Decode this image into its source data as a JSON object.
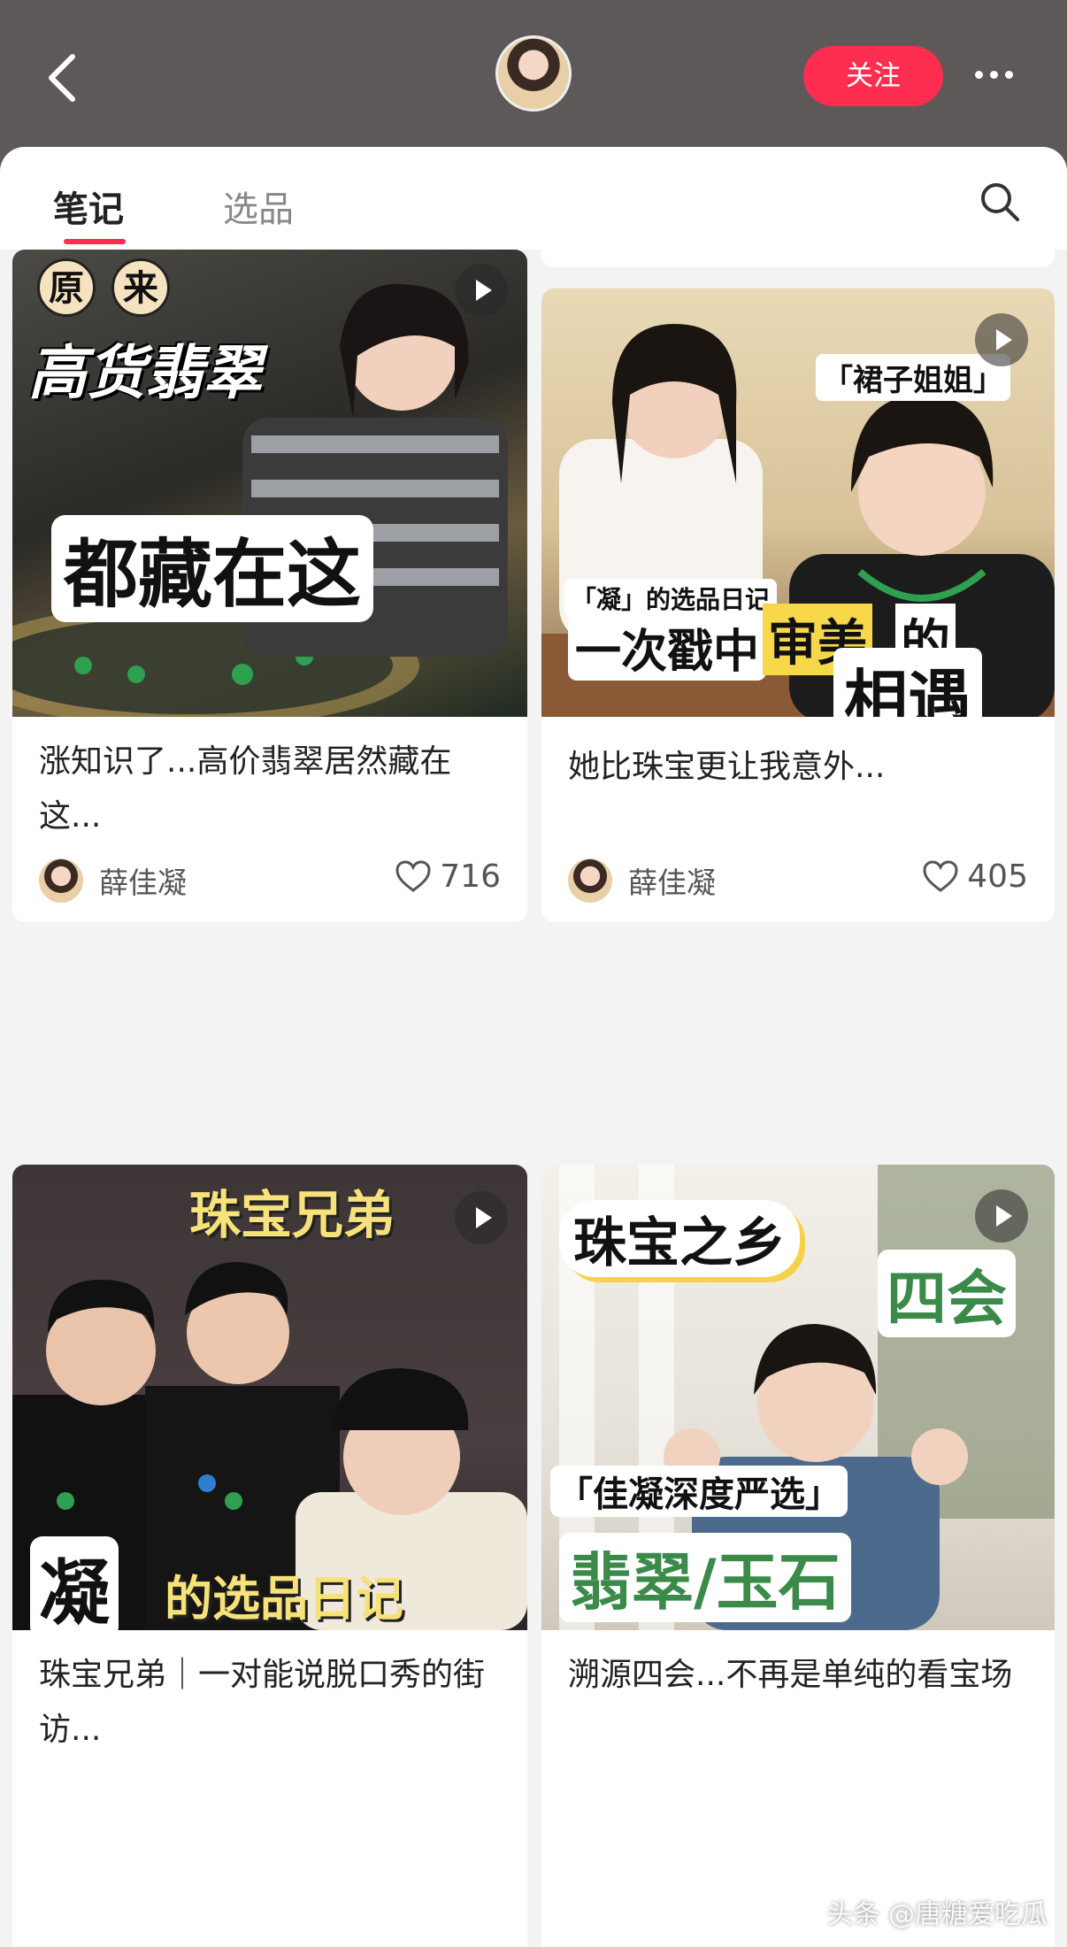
{
  "header": {
    "follow_label": "关注"
  },
  "tabs": [
    {
      "label": "笔记",
      "active": true
    },
    {
      "label": "选品",
      "active": false
    }
  ],
  "cards": [
    {
      "cover_text": [
        "原",
        "来",
        "高货翡翠",
        "都藏在这"
      ],
      "title": "涨知识了...高价翡翠居然藏在这...",
      "author": "薛佳凝",
      "likes": "716"
    },
    {
      "cover_text": [
        "「裙子姐姐」",
        "「凝」的选品日记",
        "一次戳中",
        "审美",
        "的",
        "相遇"
      ],
      "title": "她比珠宝更让我意外...",
      "author": "薛佳凝",
      "likes": "405"
    },
    {
      "cover_text": [
        "珠宝兄弟",
        "凝",
        "的选品日记"
      ],
      "title": "珠宝兄弟｜一对能说脱口秀的街访..."
    },
    {
      "cover_text": [
        "珠宝之乡",
        "四会",
        "「佳凝深度严选」",
        "翡翠/玉石"
      ],
      "title": "溯源四会...不再是单纯的看宝场"
    }
  ],
  "watermark": "头条 @唐糖爱吃瓜"
}
